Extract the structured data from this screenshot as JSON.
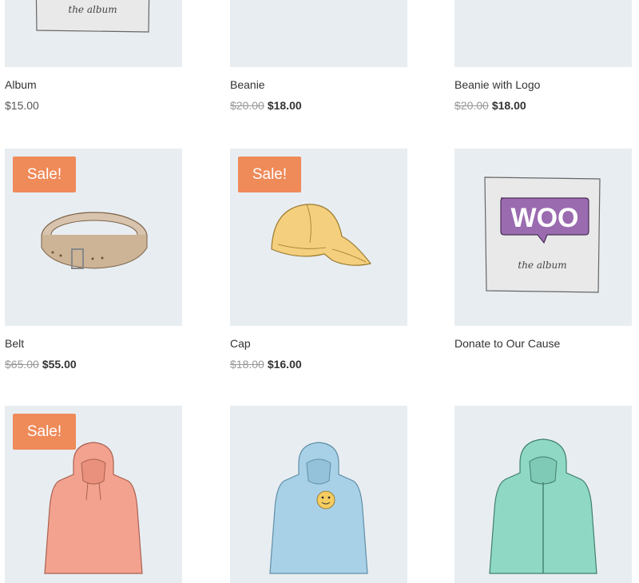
{
  "products": [
    {
      "name": "Album",
      "price": "$15.00",
      "image": "woo-album",
      "sale": false
    },
    {
      "name": "Beanie",
      "regular_price": "$20.00",
      "sale_price": "$18.00",
      "image": "beanie",
      "sale": true
    },
    {
      "name": "Beanie with Logo",
      "regular_price": "$20.00",
      "sale_price": "$18.00",
      "image": "beanie-logo",
      "sale": true
    },
    {
      "name": "Belt",
      "regular_price": "$65.00",
      "sale_price": "$55.00",
      "image": "belt",
      "sale": true
    },
    {
      "name": "Cap",
      "regular_price": "$18.00",
      "sale_price": "$16.00",
      "image": "cap",
      "sale": true
    },
    {
      "name": "Donate to Our Cause",
      "image": "woo-album",
      "sale": false
    },
    {
      "name": "",
      "image": "hoodie-pink",
      "sale": true
    },
    {
      "name": "",
      "image": "hoodie-logo",
      "sale": false
    },
    {
      "name": "",
      "image": "hoodie-zip",
      "sale": false
    }
  ],
  "badges": {
    "sale": "Sale!"
  },
  "album_art": {
    "logo_text": "WOO",
    "caption": "the album"
  },
  "colors": {
    "sale_badge": "#ef8a59",
    "image_bg": "#e8edf1",
    "beanie": "#f09b82",
    "beanie_logo": "#a8d1e7",
    "belt": "#d8c4ae",
    "cap": "#f4cf7d",
    "hoodie_pink": "#f3a28f",
    "hoodie_blue": "#a8d1e7",
    "hoodie_green": "#8fd8c4",
    "woo_purple": "#9b6bb0"
  }
}
